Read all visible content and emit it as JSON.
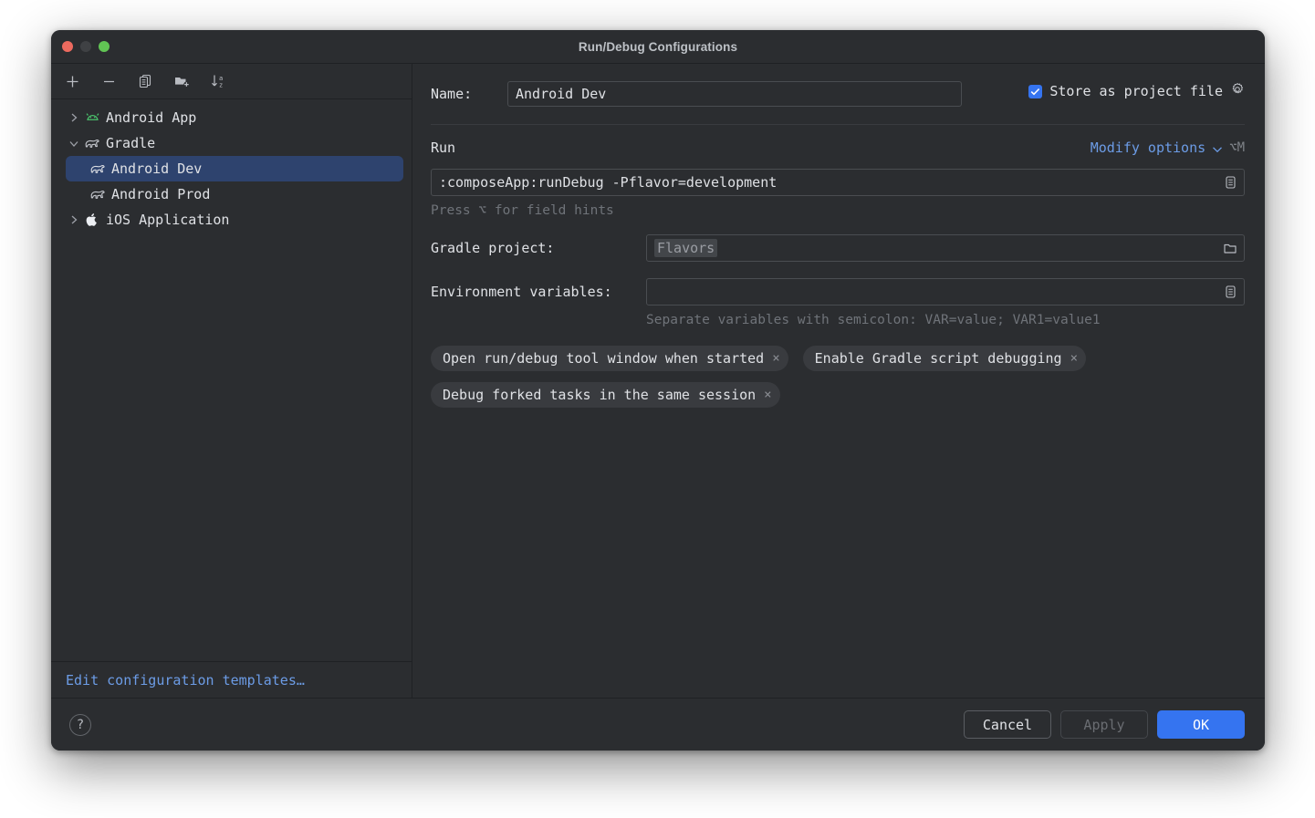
{
  "window": {
    "title": "Run/Debug Configurations",
    "traffic_lights": [
      "close-red",
      "minimize-gray",
      "maximize-green"
    ],
    "accent_color": "#3574f0",
    "link_color": "#6c9ce6",
    "selected_row_color": "#2e436e",
    "background_color": "#2b2d30"
  },
  "left_pane": {
    "toolbar": [
      {
        "name": "add-configuration-button",
        "icon": "plus-icon"
      },
      {
        "name": "remove-configuration-button",
        "icon": "minus-icon"
      },
      {
        "name": "copy-configuration-button",
        "icon": "copy-icon"
      },
      {
        "name": "add-folder-button",
        "icon": "folder-add-icon"
      },
      {
        "name": "sort-configurations-button",
        "icon": "sort-az-icon"
      }
    ],
    "tree": [
      {
        "label": "Android App",
        "icon": "android-icon",
        "twisty": "collapsed",
        "level": 0,
        "selected": false
      },
      {
        "label": "Gradle",
        "icon": "gradle-elephant-icon",
        "twisty": "expanded",
        "level": 0,
        "selected": false
      },
      {
        "label": "Android Dev",
        "icon": "gradle-elephant-icon",
        "twisty": "none",
        "level": 1,
        "selected": true
      },
      {
        "label": "Android Prod",
        "icon": "gradle-elephant-icon",
        "twisty": "none",
        "level": 1,
        "selected": false
      },
      {
        "label": "iOS Application",
        "icon": "apple-icon",
        "twisty": "collapsed",
        "level": 0,
        "selected": false
      }
    ],
    "footer_link": "Edit configuration templates…"
  },
  "form": {
    "name_label": "Name:",
    "name_value": "Android Dev",
    "store_as_project_file": {
      "label": "Store as project file",
      "checked": true,
      "gear_icon": "gear-icon"
    },
    "run_section_title": "Run",
    "modify_options": {
      "label": "Modify options",
      "chevron": "chevron-down-icon",
      "shortcut": "⌥M"
    },
    "run_command": ":composeApp:runDebug -Pflavor=development",
    "run_hint": "Press ⌥ for field hints",
    "gradle_project_label": "Gradle project:",
    "gradle_project_value": "Flavors",
    "env_vars_label": "Environment variables:",
    "env_vars_value": "",
    "env_vars_hint": "Separate variables with semicolon: VAR=value; VAR1=value1",
    "chips": [
      {
        "label": "Open run/debug tool window when started",
        "close": "×"
      },
      {
        "label": "Enable Gradle script debugging",
        "close": "×"
      },
      {
        "label": "Debug forked tasks in the same session",
        "close": "×"
      }
    ]
  },
  "bottom_bar": {
    "help": "?",
    "cancel": "Cancel",
    "apply": "Apply",
    "ok": "OK"
  }
}
